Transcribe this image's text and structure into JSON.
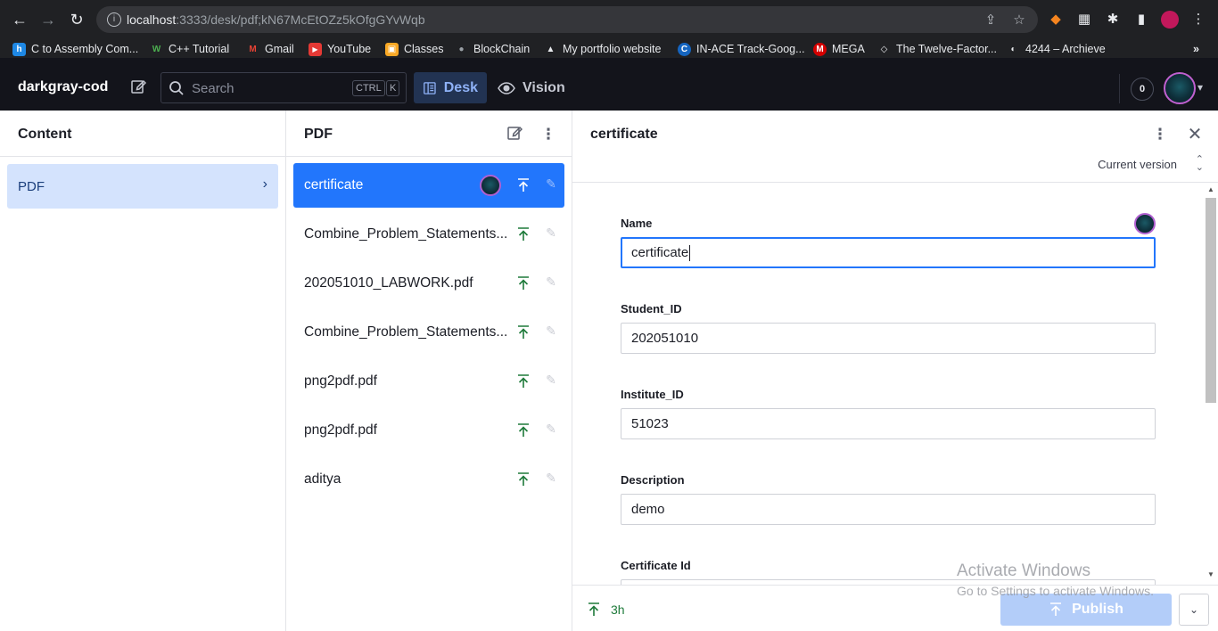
{
  "browser": {
    "url_host": "localhost",
    "url_rest": ":3333/desk/pdf;kN67McEtOZz5kOfgGYvWqb",
    "bookmarks": [
      {
        "label": "C to Assembly Com...",
        "icon": "h",
        "color": "#1e88e5"
      },
      {
        "label": "C++ Tutorial",
        "icon": "W",
        "color": "#2e7d32"
      },
      {
        "label": "Gmail",
        "icon": "M",
        "color": "#d93025"
      },
      {
        "label": "YouTube",
        "icon": "▶",
        "color": "#e53935"
      },
      {
        "label": "Classes",
        "icon": "▣",
        "color": "#f9a825"
      },
      {
        "label": "BlockChain",
        "icon": "●",
        "color": "#555555"
      },
      {
        "label": "My portfolio website",
        "icon": "▲",
        "color": "#333333"
      },
      {
        "label": "IN-ACE Track-Goog...",
        "icon": "C",
        "color": "#1565c0"
      },
      {
        "label": "MEGA",
        "icon": "M",
        "color": "#d50000"
      },
      {
        "label": "The Twelve-Factor...",
        "icon": "◇",
        "color": "#202124"
      },
      {
        "label": "4244 – Archieve",
        "icon": "◐",
        "color": "#5f6368"
      }
    ]
  },
  "app": {
    "brand": "darkgray-cod",
    "search_placeholder": "Search",
    "kbd_ctrl": "CTRL",
    "kbd_k": "K",
    "tool_desk": "Desk",
    "tool_vision": "Vision",
    "notification_count": "0"
  },
  "content_pane": {
    "title": "Content",
    "items": [
      {
        "label": "PDF"
      }
    ]
  },
  "list_pane": {
    "title": "PDF",
    "documents": [
      {
        "title": "certificate"
      },
      {
        "title": "Combine_Problem_Statements..."
      },
      {
        "title": "202051010_LABWORK.pdf"
      },
      {
        "title": "Combine_Problem_Statements..."
      },
      {
        "title": "png2pdf.pdf"
      },
      {
        "title": "png2pdf.pdf"
      },
      {
        "title": "aditya"
      }
    ]
  },
  "editor": {
    "title": "certificate",
    "version": "Current version",
    "fields": [
      {
        "label": "Name",
        "value": "certificate"
      },
      {
        "label": "Student_ID",
        "value": "202051010"
      },
      {
        "label": "Institute_ID",
        "value": "51023"
      },
      {
        "label": "Description",
        "value": "demo"
      },
      {
        "label": "Certificate Id",
        "value": ""
      }
    ],
    "footer_time": "3h",
    "publish_label": "Publish"
  },
  "os": {
    "watermark_title": "Activate Windows",
    "watermark_sub": "Go to Settings to activate Windows."
  },
  "colors": {
    "accent": "#2276fc",
    "selected_bg": "#d4e3fd",
    "published_green": "#1e7a3a"
  }
}
